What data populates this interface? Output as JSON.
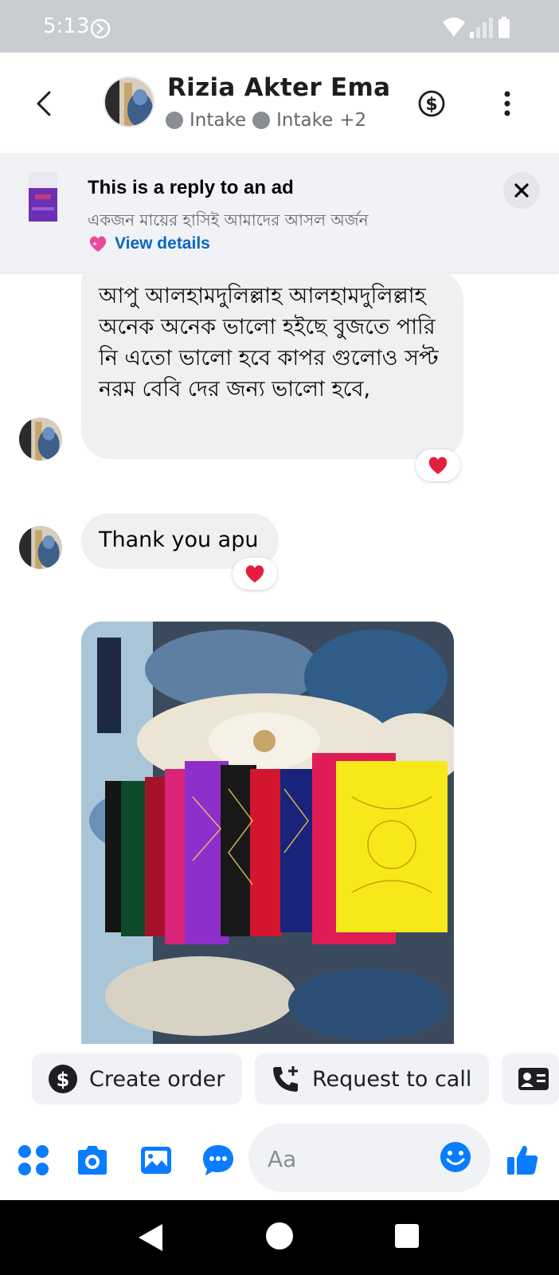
{
  "status": {
    "time": "5:13"
  },
  "header": {
    "name": "Rizia Akter Ema",
    "tags": [
      {
        "label": "Intake"
      },
      {
        "label": "Intake"
      }
    ],
    "tags_more": "+2"
  },
  "ad": {
    "title": "This is a reply to an ad",
    "subtitle": "একজন মায়ের হাসিই আমাদের আসল অর্জন",
    "link_label": "View details"
  },
  "messages": [
    {
      "text": "আপু আলহামদুলিল্লাহ আলহামদুলিল্লাহ অনেক অনেক ভালো হইছে বুজতে পারি নি এতো ভালো হবে কাপর গুলোও সপ্ট নরম বেবি দের জন্য ভালো হবে,",
      "reaction": "heart"
    },
    {
      "text": "Thank you apu",
      "reaction": "heart"
    },
    {
      "type": "photo",
      "subject": "folded embroidered fabrics"
    }
  ],
  "quick_actions": {
    "create_order": "Create order",
    "request_call": "Request to call"
  },
  "composer": {
    "placeholder": "Aa"
  },
  "colors": {
    "accent": "#0a7cff",
    "bubble": "#f0f0f0",
    "link": "#0a66c2",
    "reaction": "#e41e3f"
  }
}
